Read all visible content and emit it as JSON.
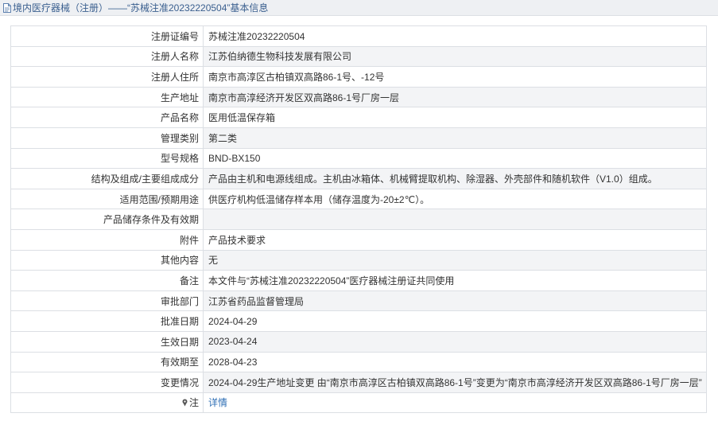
{
  "header": {
    "title": "境内医疗器械（注册）——“苏械注准20232220504”基本信息",
    "icon": "document-icon"
  },
  "rows": [
    {
      "label": "注册证编号",
      "value": "苏械注准20232220504"
    },
    {
      "label": "注册人名称",
      "value": "江苏伯纳德生物科技发展有限公司"
    },
    {
      "label": "注册人住所",
      "value": "南京市高淳区古柏镇双高路86-1号、-12号"
    },
    {
      "label": "生产地址",
      "value": "南京市高淳经济开发区双高路86-1号厂房一层"
    },
    {
      "label": "产品名称",
      "value": "医用低温保存箱"
    },
    {
      "label": "管理类别",
      "value": "第二类"
    },
    {
      "label": "型号规格",
      "value": "BND-BX150"
    },
    {
      "label": "结构及组成/主要组成成分",
      "value": "产品由主机和电源线组成。主机由冰箱体、机械臂提取机构、除湿器、外壳部件和随机软件（V1.0）组成。"
    },
    {
      "label": "适用范围/预期用途",
      "value": "供医疗机构低温储存样本用（储存温度为-20±2℃）。"
    },
    {
      "label": "产品储存条件及有效期",
      "value": ""
    },
    {
      "label": "附件",
      "value": "产品技术要求"
    },
    {
      "label": "其他内容",
      "value": "无"
    },
    {
      "label": "备注",
      "value": "本文件与“苏械注准20232220504”医疗器械注册证共同使用"
    },
    {
      "label": "审批部门",
      "value": "江苏省药品监督管理局"
    },
    {
      "label": "批准日期",
      "value": "2024-04-29"
    },
    {
      "label": "生效日期",
      "value": "2023-04-24"
    },
    {
      "label": "有效期至",
      "value": "2028-04-23"
    },
    {
      "label": "变更情况",
      "value": "2024-04-29生产地址变更 由“南京市高淳区古柏镇双高路86-1号”变更为“南京市高淳经济开发区双高路86-1号厂房一层”"
    }
  ],
  "note_row": {
    "label": "注",
    "icon": "pin-icon",
    "link_text": "详情"
  },
  "colors": {
    "title_text": "#3a5f8f",
    "link": "#2f6fb5",
    "border": "#dcdfe4",
    "stripe": "#f3f4f6"
  }
}
